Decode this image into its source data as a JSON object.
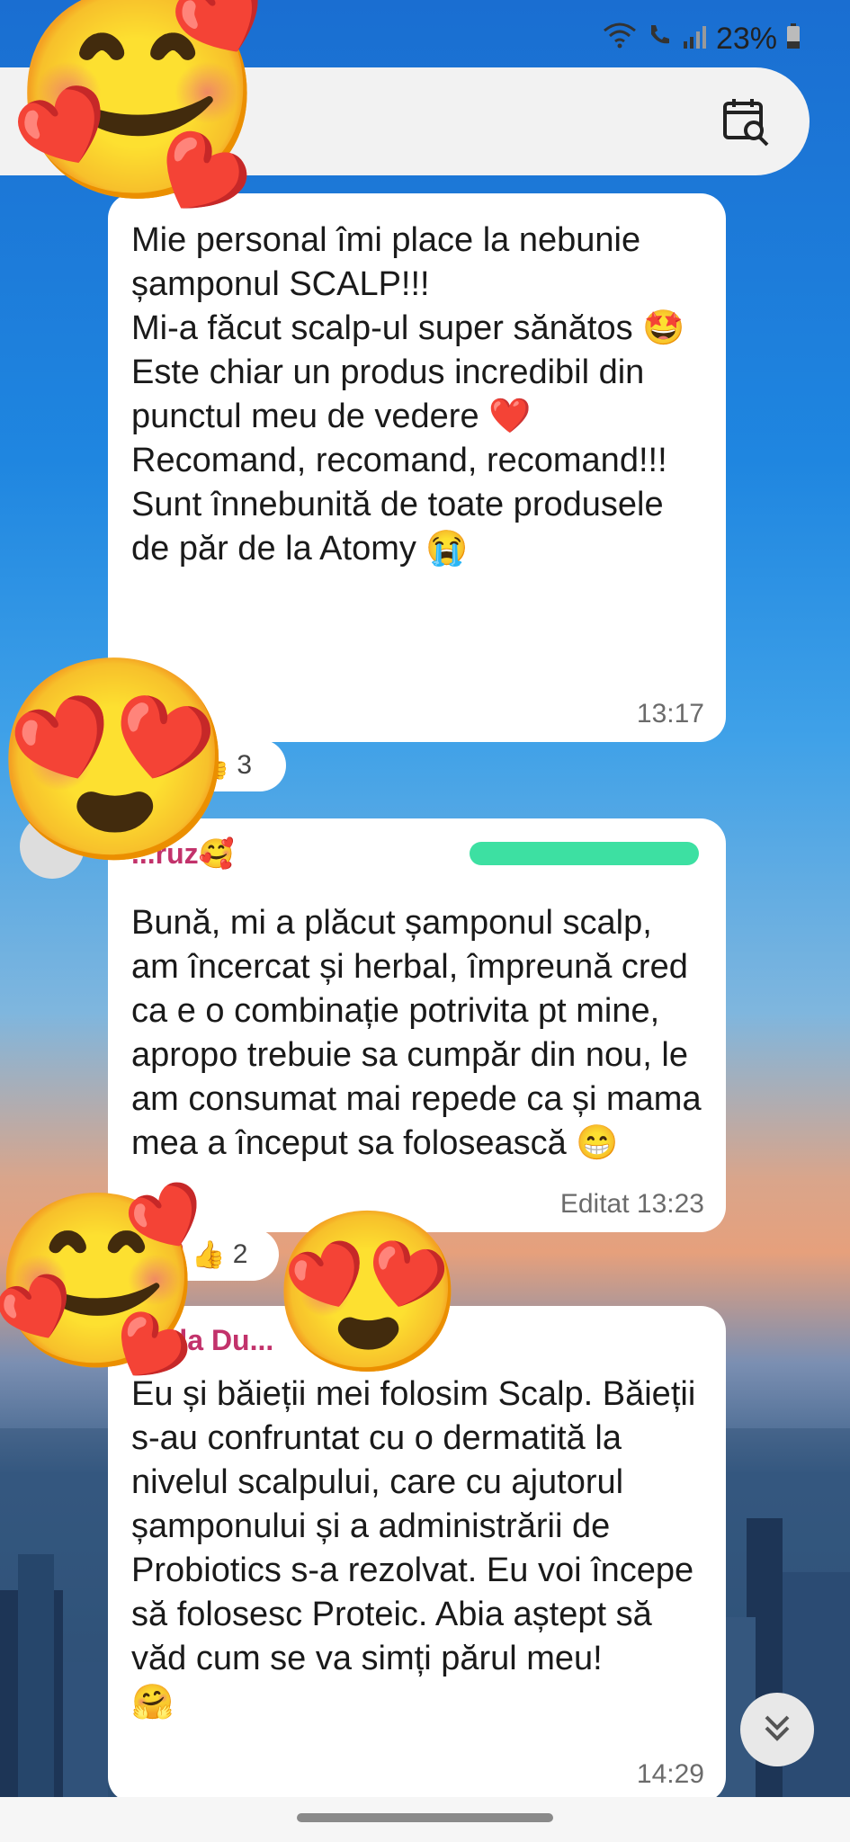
{
  "status": {
    "battery": "23%"
  },
  "messages": [
    {
      "text": "Mie personal îmi place la nebunie șamponul SCALP!!!\nMi-a făcut scalp-ul super sănătos 🤩 Este chiar un produs incredibil din punctul meu de vedere ❤️ Recomand, recomand, recomand!!!\nSunt înnebunită de toate produsele de păr de la Atomy 😭",
      "time": "13:17",
      "reaction_count": "3"
    },
    {
      "sender": "...ruz🥰",
      "text": "Bună, mi a plăcut șamponul scalp, am încercat și herbal, împreună cred ca e o combinație potrivita pt mine, apropo trebuie sa cumpăr din nou, le am consumat mai repede ca și mama mea a început sa folosească 😁",
      "edited": "Editat",
      "time": "13:23",
      "reaction_count": "2"
    },
    {
      "sender": "...iela Du...",
      "text": "Eu și băieții mei folosim Scalp. Băieții s-au confruntat cu o dermatită la nivelul scalpului, care cu ajutorul șamponului și a administrării de Probiotics s-a rezolvat. Eu voi începe să folosesc Proteic. Abia aștept să văd cum se va simți părul meu!\n🤗",
      "time": "14:29"
    }
  ],
  "icons": {
    "calendar_search": "calendar-search-icon",
    "scroll_down": "double-chevron-down-icon"
  },
  "colors": {
    "sender": "#c2326b",
    "bubble": "#ffffff"
  }
}
